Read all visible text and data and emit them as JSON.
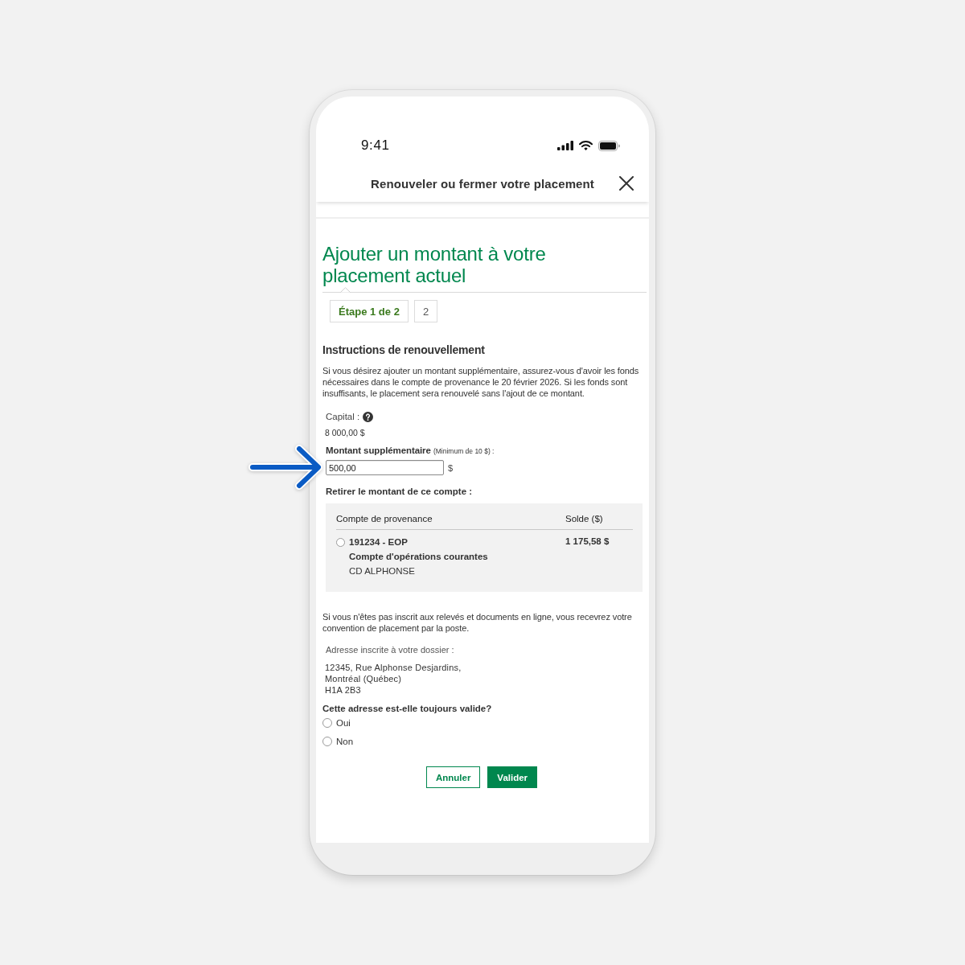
{
  "status_bar": {
    "time": "9:41"
  },
  "header": {
    "title": "Renouveler ou fermer votre placement"
  },
  "page": {
    "title": "Ajouter un montant à votre placement actuel",
    "steps": [
      {
        "label": "Étape 1 de 2",
        "selected": true
      },
      {
        "label": "2",
        "selected": false
      }
    ]
  },
  "instructions": {
    "heading": "Instructions de renouvellement",
    "text": "Si vous désirez ajouter un montant supplémentaire, assurez-vous d'avoir les fonds nécessaires dans le compte de provenance le 20 février 2026. Si les fonds sont insuffisants, le placement sera renouvelé sans l'ajout de ce montant."
  },
  "capital": {
    "label": "Capital :",
    "value": "8 000,00 $"
  },
  "amount": {
    "label": "Montant supplémentaire",
    "hint": "(Minimum de 10 $) :",
    "value": "500,00",
    "unit": "$"
  },
  "withdrawal": {
    "label": "Retirer le montant de ce compte :",
    "columns": [
      "Compte de provenance",
      "Solde ($)"
    ],
    "accounts": [
      {
        "number": "191234 - EOP",
        "type": "Compte d'opérations courantes",
        "holder": "CD ALPHONSE",
        "balance": "1 175,58 $",
        "selected": false
      }
    ]
  },
  "mail_notice": "Si vous n'êtes pas inscrit aux relevés et documents en ligne, vous recevrez votre convention de placement par la poste.",
  "address": {
    "label": "Adresse inscrite à votre dossier :",
    "lines": [
      "12345, Rue Alphonse Desjardins,",
      "Montréal (Québec)",
      "H1A 2B3"
    ]
  },
  "validity": {
    "question": "Cette adresse est-elle toujours valide?",
    "options": [
      {
        "label": "Oui",
        "selected": false
      },
      {
        "label": "Non",
        "selected": false
      }
    ]
  },
  "actions": [
    {
      "label": "Annuler",
      "kind": "secondary"
    },
    {
      "label": "Valider",
      "kind": "primary"
    }
  ]
}
